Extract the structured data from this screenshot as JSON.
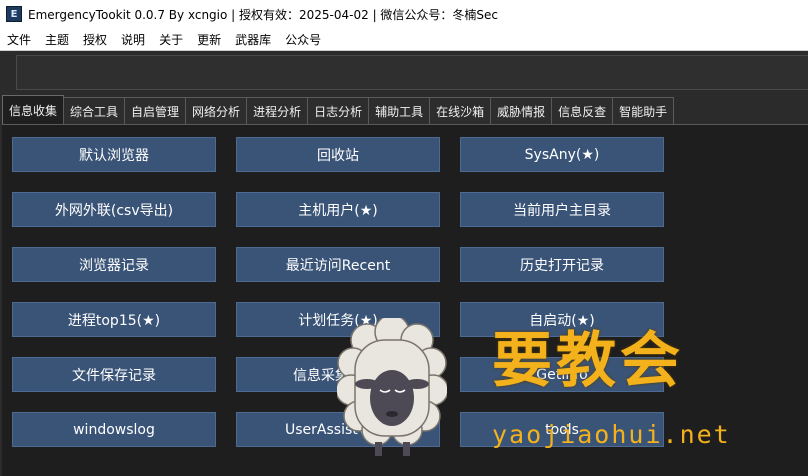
{
  "window": {
    "title": "EmergencyTookit 0.0.7 By xcngio | 授权有效：2025-04-02 | 微信公众号：冬楠Sec",
    "icon": "app-logo-icon"
  },
  "menubar": {
    "items": [
      "文件",
      "主题",
      "授权",
      "说明",
      "关于",
      "更新",
      "武器库",
      "公众号"
    ]
  },
  "tabs": {
    "items": [
      "信息收集",
      "综合工具",
      "自启管理",
      "网络分析",
      "进程分析",
      "日志分析",
      "辅助工具",
      "在线沙箱",
      "威胁情报",
      "信息反查",
      "智能助手"
    ],
    "active_index": 0
  },
  "buttons": {
    "col1": [
      "默认浏览器",
      "外网外联(csv导出)",
      "浏览器记录",
      "进程top15(★)",
      "文件保存记录",
      "windowslog"
    ],
    "col2": [
      "回收站",
      "主机用户(★)",
      "最近访问Recent",
      "计划任务(★)",
      "信息采集(bat)",
      "UserAssistView"
    ],
    "col3": [
      "SysAny(★)",
      "当前用户主目录",
      "历史打开记录",
      "自启动(★)",
      "GetInfo",
      "tools"
    ]
  },
  "watermark": {
    "title": "要教会",
    "url": "yaojiaohui.net"
  },
  "colors": {
    "button_bg": "#3a5478",
    "panel_bg": "#1e1e1e",
    "watermark": "#f3b21b"
  }
}
